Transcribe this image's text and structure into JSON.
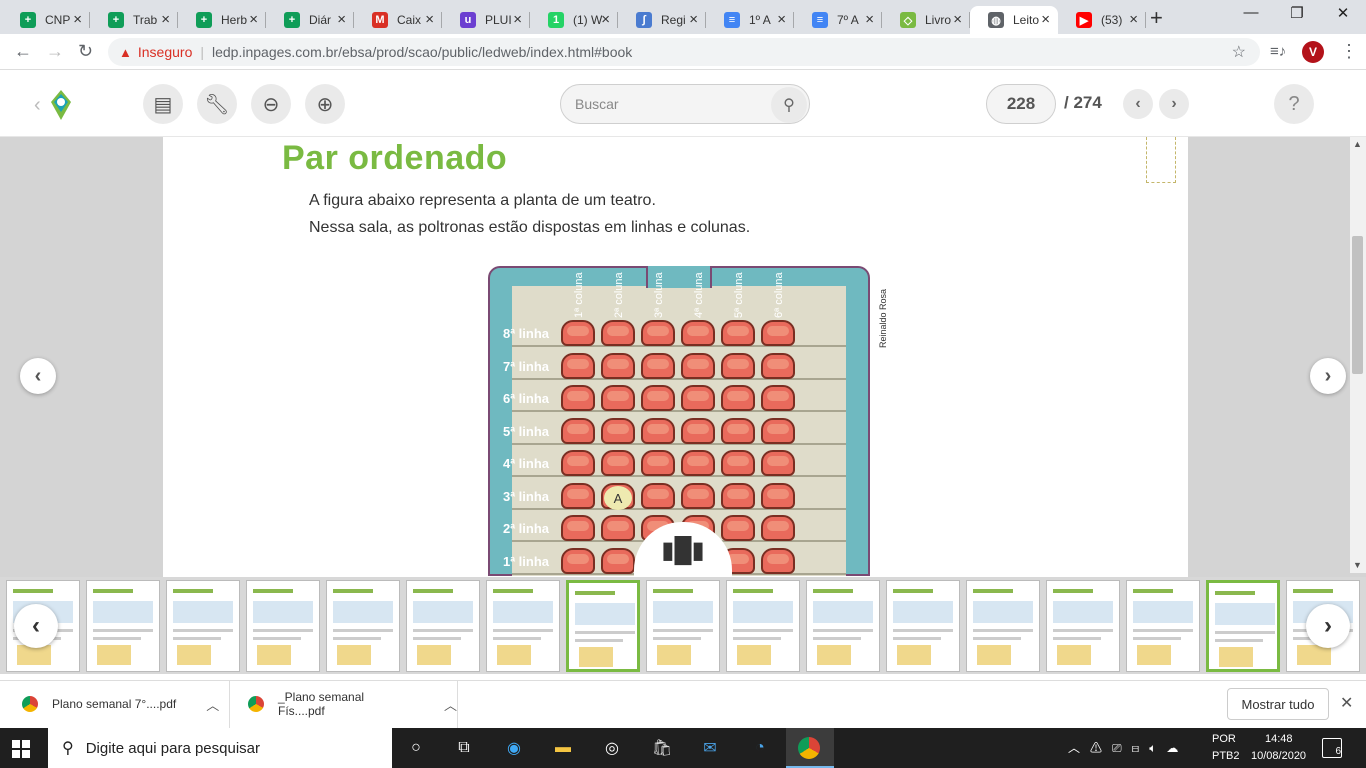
{
  "browser": {
    "tabs": [
      {
        "title": "CNP",
        "icon": "sheets-icon",
        "color": "#0f9d58",
        "glyph": "+"
      },
      {
        "title": "Trab",
        "icon": "sheets-icon",
        "color": "#0f9d58",
        "glyph": "+"
      },
      {
        "title": "Herb",
        "icon": "sheets-icon",
        "color": "#0f9d58",
        "glyph": "+"
      },
      {
        "title": "Diár",
        "icon": "sheets-icon",
        "color": "#0f9d58",
        "glyph": "+"
      },
      {
        "title": "Caix",
        "icon": "gmail-icon",
        "color": "#d93025",
        "glyph": "M"
      },
      {
        "title": "PLUI",
        "icon": "purple-app-icon",
        "color": "#6c3fd1",
        "glyph": "u"
      },
      {
        "title": "(1) W",
        "icon": "whatsapp-icon",
        "color": "#25d366",
        "glyph": "1"
      },
      {
        "title": "Regi",
        "icon": "tool-icon",
        "color": "#4a7bd0",
        "glyph": "∫"
      },
      {
        "title": "1º A",
        "icon": "docs-icon",
        "color": "#4285f4",
        "glyph": "≡"
      },
      {
        "title": "7º A",
        "icon": "docs-icon",
        "color": "#4285f4",
        "glyph": "≡"
      },
      {
        "title": "Livro",
        "icon": "ftd-icon",
        "color": "#7aba42",
        "glyph": "◇"
      },
      {
        "title": "Leito",
        "icon": "globe-icon",
        "color": "#5f6368",
        "glyph": "◍",
        "active": true
      },
      {
        "title": "(53)",
        "icon": "youtube-icon",
        "color": "#ff0000",
        "glyph": "▶"
      }
    ],
    "new_tab": "+",
    "minimize": "—",
    "maximize": "❐",
    "close": "✕",
    "insecure_label": "Inseguro",
    "url": "ledp.inpages.com.br/ebsa/prod/scao/public/ledweb/index.html#book",
    "profile_initial": "V"
  },
  "reader": {
    "search_placeholder": "Buscar",
    "current_page": "228",
    "total_pages": "/ 274",
    "help": "?"
  },
  "book_page": {
    "title": "Par ordenado",
    "line1": "A figura abaixo representa a planta de um teatro.",
    "line2": "Nessa sala, as poltronas estão dispostas em linhas e colunas.",
    "credit": "Reinaldo Rosa",
    "point_label": "A",
    "columns": [
      "1ª coluna",
      "2ª coluna",
      "3ª coluna",
      "4ª coluna",
      "5ª coluna",
      "6ª coluna"
    ],
    "rows": [
      "8ª linha",
      "7ª linha",
      "6ª linha",
      "5ª linha",
      "4ª linha",
      "3ª linha",
      "2ª linha",
      "1ª linha"
    ]
  },
  "downloads": {
    "items": [
      "Plano semanal 7°....pdf",
      "_Plano semanal Fís....pdf"
    ],
    "show_all": "Mostrar tudo"
  },
  "taskbar": {
    "search_placeholder": "Digite aqui para pesquisar",
    "lang1": "POR",
    "lang2": "PTB2",
    "time": "14:48",
    "date": "10/08/2020",
    "notifications": "6"
  },
  "colors": {
    "accent_green": "#7aba42",
    "theater_frame": "#6fb9c0",
    "seat": "#e96a5c"
  }
}
